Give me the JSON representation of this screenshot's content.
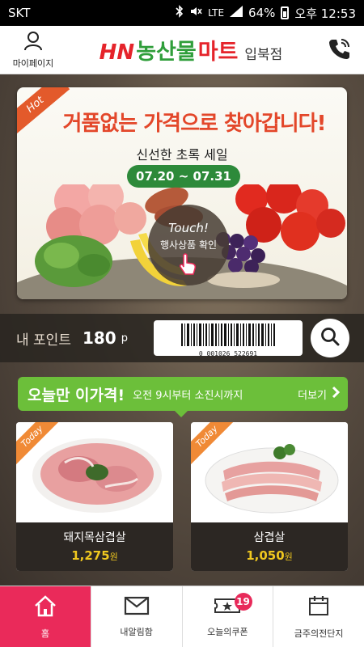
{
  "status": {
    "carrier": "SKT",
    "network": "LTE",
    "battery": "64%",
    "time": "오후 12:53"
  },
  "header": {
    "mypage_label": "마이페이지",
    "logo_hn": "HN",
    "logo_green": "농산물",
    "logo_red": "마트",
    "branch": "입북점"
  },
  "banner": {
    "hot": "Hot",
    "headline": "거품없는 가격으로 찾아갑니다!",
    "subtitle": "신선한 초록 세일",
    "dates": "07.20 ~ 07.31",
    "touch_title": "Touch!",
    "touch_desc": "행사상품 확인"
  },
  "points": {
    "label": "내 포인트",
    "value": "180",
    "unit": "p",
    "barcode_number": "0 001026 522691"
  },
  "today": {
    "title": "오늘만 이가격!",
    "desc": "오전 9시부터 소진시까지",
    "more": "더보기"
  },
  "products": [
    {
      "tag": "Today",
      "name": "돼지목삼겹살",
      "price": "1,275",
      "unit": "원"
    },
    {
      "tag": "Today",
      "name": "삼겹살",
      "price": "1,050",
      "unit": "원"
    }
  ],
  "tabs": [
    {
      "label": "홈",
      "icon": "home-icon"
    },
    {
      "label": "내알림함",
      "icon": "mail-icon"
    },
    {
      "label": "오늘의쿠폰",
      "icon": "coupon-icon",
      "badge": "19"
    },
    {
      "label": "금주의전단지",
      "icon": "calendar-icon"
    }
  ],
  "colors": {
    "accent_pink": "#ea2a5a",
    "green": "#6cbf3a",
    "price_yellow": "#f0c81f",
    "headline_red": "#e3472a"
  }
}
